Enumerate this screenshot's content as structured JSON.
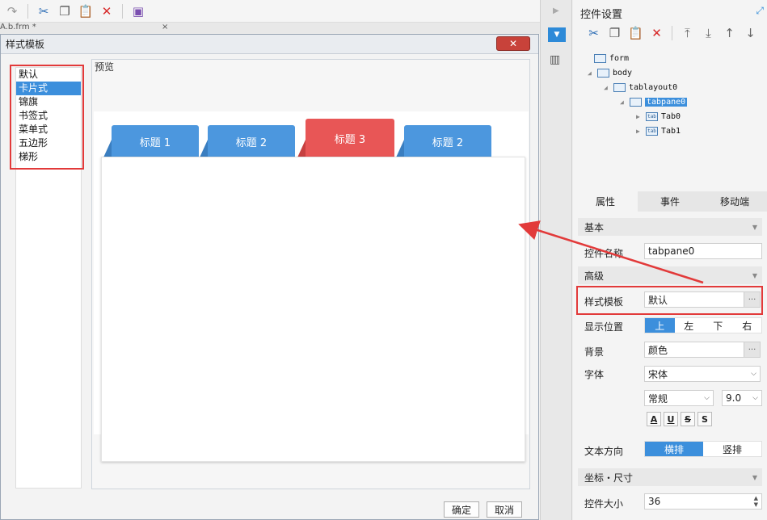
{
  "top_toolbar": {
    "icons": [
      "redo-icon",
      "cut-icon",
      "copy-icon",
      "paste-icon",
      "delete-icon",
      "save-template-icon"
    ]
  },
  "behind": {
    "tab_label": "A.b.frm *",
    "close_glyph": "×"
  },
  "dialog": {
    "title": "样式模板",
    "close_glyph": "✕",
    "styles": [
      "默认",
      "卡片式",
      "锦旗",
      "书签式",
      "菜单式",
      "五边形",
      "梯形"
    ],
    "selected_style_index": 1,
    "preview_label": "预览",
    "tabs": [
      "标题 1",
      "标题 2",
      "标题 3",
      "标题 2"
    ],
    "active_tab_index": 2,
    "ok_label": "确定",
    "cancel_label": "取消"
  },
  "right_panel": {
    "title": "控件设置",
    "toolbar_icons": [
      "cut-icon",
      "copy-icon",
      "paste-icon",
      "delete-icon",
      "move-top-icon",
      "move-bottom-icon",
      "move-up-icon",
      "move-down-icon"
    ],
    "tree": [
      {
        "label": "form",
        "icon": "form-icon"
      },
      {
        "label": "body",
        "icon": "body-icon"
      },
      {
        "label": "tablayout0",
        "icon": "layout-icon"
      },
      {
        "label": "tabpane0",
        "icon": "tabpane-icon"
      },
      {
        "label": "Tab0",
        "icon": "tab-icon"
      },
      {
        "label": "Tab1",
        "icon": "tab-icon"
      }
    ],
    "tree_icon_text": "tab",
    "tabs": [
      "属性",
      "事件",
      "移动端"
    ],
    "sections": {
      "basic": "基本",
      "advanced": "高级",
      "position_size": "坐标・尺寸"
    },
    "props": {
      "name_label": "控件名称",
      "name_value": "tabpane0",
      "template_label": "样式模板",
      "template_value": "默认",
      "display_pos_label": "显示位置",
      "display_pos_options": [
        "上",
        "左",
        "下",
        "右"
      ],
      "background_label": "背景",
      "background_value": "颜色",
      "font_label": "字体",
      "font_family": "宋体",
      "font_style": "常规",
      "font_size": "9.0",
      "fmt_buttons": [
        "A",
        "U",
        "S",
        "S"
      ],
      "text_dir_label": "文本方向",
      "text_dir_options": [
        "横排",
        "竖排"
      ],
      "size_label": "控件大小",
      "size_value": "36"
    }
  },
  "colors": {
    "accent": "#3c8fdc",
    "tab_blue": "#4c97de",
    "tab_red": "#e85656",
    "highlight_red": "#e23a3a"
  }
}
